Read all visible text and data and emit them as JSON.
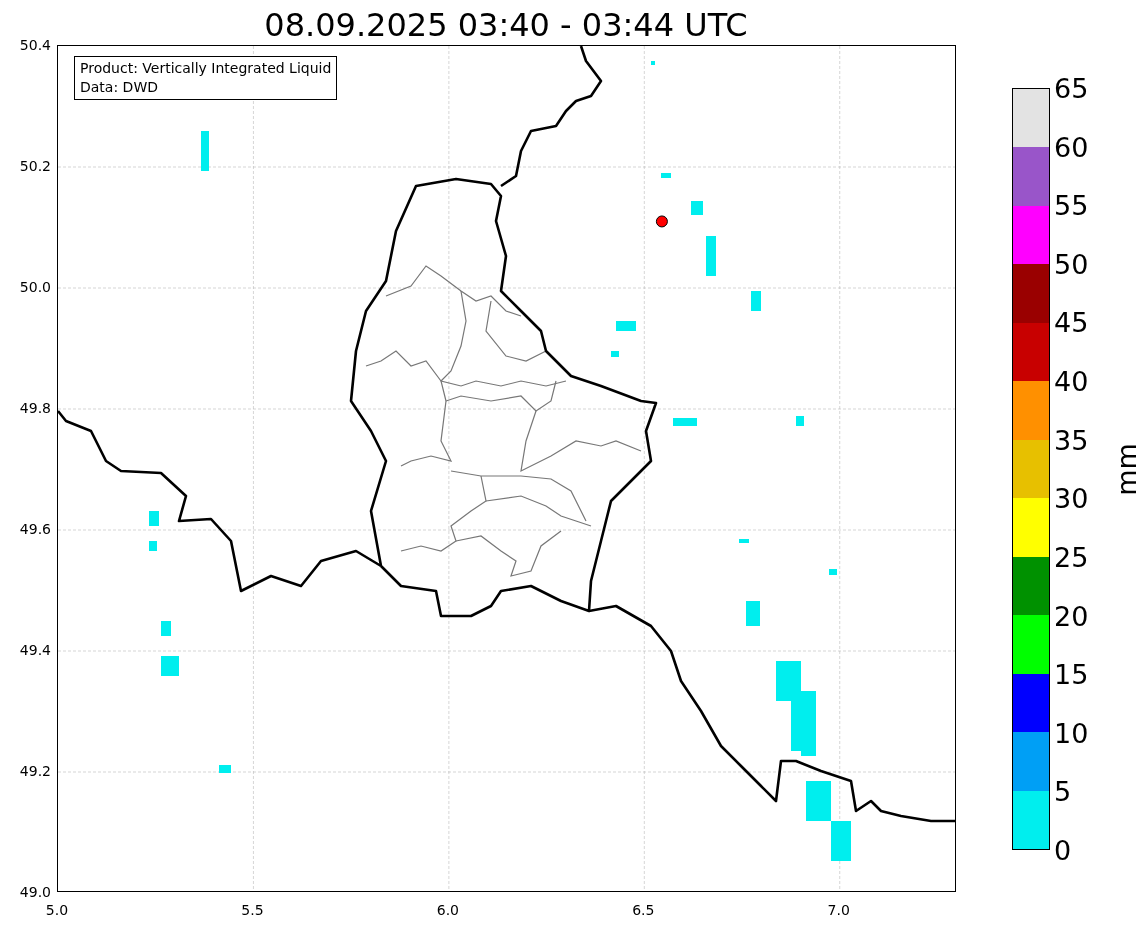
{
  "title": "08.09.2025 03:40 - 03:44 UTC",
  "legend": [
    "Product: Vertically Integrated Liquid",
    "Data: DWD"
  ],
  "xticks": [
    "5.0",
    "5.5",
    "6.0",
    "6.5",
    "7.0"
  ],
  "yticks": [
    "50.4",
    "50.2",
    "50.0",
    "49.8",
    "49.6",
    "49.4",
    "49.2",
    "49.0"
  ],
  "colorbar": {
    "label": "mm",
    "bands": [
      {
        "color": "#e3e3e3"
      },
      {
        "color": "#9955c9"
      },
      {
        "color": "#ff00ff"
      },
      {
        "color": "#9a0000"
      },
      {
        "color": "#c80000"
      },
      {
        "color": "#ff9000"
      },
      {
        "color": "#e7c000"
      },
      {
        "color": "#ffff00"
      },
      {
        "color": "#009100"
      },
      {
        "color": "#00ff00"
      },
      {
        "color": "#0000ff"
      },
      {
        "color": "#009ff5"
      },
      {
        "color": "#00eeee"
      }
    ],
    "ticks": [
      "65",
      "60",
      "55",
      "50",
      "45",
      "40",
      "35",
      "30",
      "25",
      "20",
      "15",
      "10",
      "5",
      "0"
    ]
  }
}
